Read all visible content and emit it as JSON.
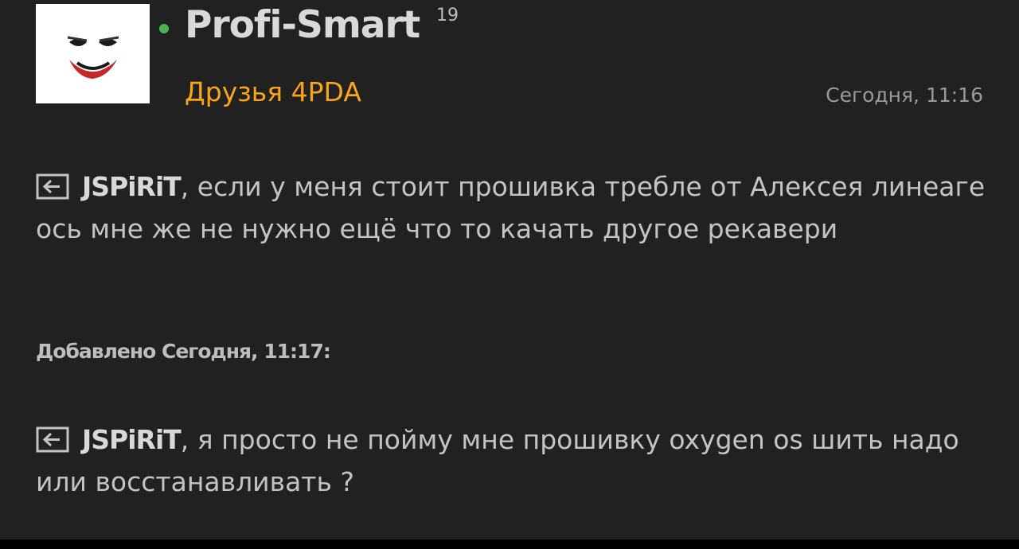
{
  "post": {
    "username": "Profi-Smart",
    "reputation": "19",
    "user_group": "Друзья 4PDA",
    "timestamp": "Сегодня, 11:16",
    "status_color": "#4caf50",
    "group_color": "#f9a51a",
    "avatar_icon": "joker-face-icon"
  },
  "messages": [
    {
      "reply_icon": "quote-reply-icon",
      "reply_to": "JSPiRiT",
      "text": ", если у меня стоит прошивка требле от Алексея линеаге ось мне же не нужно ещё что то качать другое рекавери"
    },
    {
      "reply_icon": "quote-reply-icon",
      "reply_to": "JSPiRiT",
      "text": ", я просто не пойму мне прошивку oxygen os шить надо или восстанавливать ?"
    }
  ],
  "added_note": "Добавлено Сегодня, 11:17:"
}
